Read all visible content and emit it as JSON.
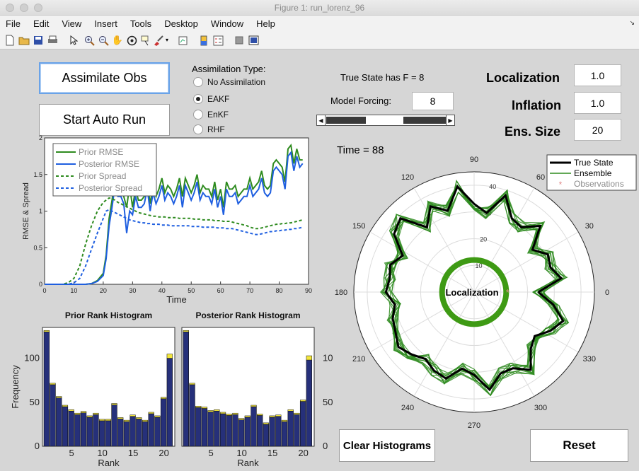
{
  "window": {
    "title": "Figure 1: run_lorenz_96"
  },
  "menu": [
    "File",
    "Edit",
    "View",
    "Insert",
    "Tools",
    "Desktop",
    "Window",
    "Help"
  ],
  "toolbar_icons": [
    "new-figure-icon",
    "open-file-icon",
    "save-icon",
    "print-icon",
    "pointer-icon",
    "zoom-in-icon",
    "zoom-out-icon",
    "pan-hand-icon",
    "rotate-3d-icon",
    "data-cursor-icon",
    "brush-icon",
    "link-plot-icon",
    "colorbar-icon",
    "legend-icon",
    "hide-plot-tools-icon",
    "show-plot-tools-icon"
  ],
  "controls": {
    "assimilate_obs": "Assimilate Obs",
    "start_auto_run": "Start Auto Run",
    "assimilation_type_label": "Assimilation Type:",
    "assimilation_types": [
      "No Assimilation",
      "EAKF",
      "EnKF",
      "RHF"
    ],
    "assimilation_selected": "EAKF",
    "true_state_text": "True State has F = 8",
    "model_forcing_label": "Model Forcing:",
    "model_forcing_value": "8",
    "forcing_slider_position": 0.52,
    "localization_label": "Localization",
    "localization_value": "1.0",
    "inflation_label": "Inflation",
    "inflation_value": "1.0",
    "ens_size_label": "Ens. Size",
    "ens_size_value": "20",
    "time_text": "Time = 88",
    "clear_histograms": "Clear Histograms",
    "reset": "Reset"
  },
  "chart_data": [
    {
      "type": "line",
      "ylabel": "RMSE & Spread",
      "xlabel": "Time",
      "xlim": [
        0,
        90
      ],
      "ylim": [
        0,
        2
      ],
      "xticks": [
        "0",
        "10",
        "20",
        "30",
        "40",
        "50",
        "60",
        "70",
        "80",
        "90"
      ],
      "yticks": [
        "0",
        "0.5",
        "1",
        "1.5",
        "2"
      ],
      "legend": [
        "Prior RMSE",
        "Posterior RMSE",
        "Prior Spread",
        "Posterior Spread"
      ],
      "legend_position": "top-left",
      "colors": {
        "prior": "#2e8b1f",
        "posterior": "#1f5fe0"
      },
      "x": [
        0,
        2,
        4,
        6,
        8,
        10,
        12,
        14,
        16,
        18,
        20,
        21,
        22,
        23,
        24,
        25,
        26,
        27,
        28,
        29,
        30,
        31,
        32,
        33,
        34,
        35,
        36,
        37,
        38,
        39,
        40,
        41,
        42,
        43,
        44,
        45,
        46,
        47,
        48,
        49,
        50,
        51,
        52,
        53,
        54,
        55,
        56,
        57,
        58,
        59,
        60,
        61,
        62,
        63,
        64,
        65,
        66,
        67,
        68,
        69,
        70,
        71,
        72,
        73,
        74,
        75,
        76,
        77,
        78,
        79,
        80,
        81,
        82,
        83,
        84,
        85,
        86,
        87,
        88
      ],
      "series": [
        {
          "name": "Prior RMSE",
          "values": [
            0,
            0,
            0,
            0,
            0,
            0,
            0,
            0,
            0.01,
            0.05,
            0.15,
            0.4,
            0.9,
            1.15,
            1.45,
            1.3,
            1.25,
            1.2,
            1.05,
            1.35,
            1.05,
            1.3,
            1.15,
            1.15,
            1.2,
            1.4,
            1.1,
            1.35,
            1.2,
            1.3,
            1.45,
            1.25,
            1.35,
            1.3,
            1.2,
            1.3,
            1.45,
            1.2,
            1.45,
            1.35,
            1.25,
            1.35,
            1.5,
            1.25,
            1.35,
            1.3,
            1.3,
            1.2,
            1.4,
            1.15,
            1.3,
            1.05,
            1.4,
            1.3,
            1.3,
            1.35,
            1.2,
            1.25,
            1.3,
            1.3,
            1.45,
            1.3,
            1.35,
            1.4,
            1.55,
            1.35,
            1.3,
            1.35,
            1.65,
            1.7,
            1.65,
            1.6,
            1.4,
            1.85,
            1.9,
            1.65,
            1.85,
            1.7,
            1.7
          ]
        },
        {
          "name": "Posterior RMSE",
          "values": [
            0,
            0,
            0,
            0,
            0,
            0,
            0,
            0,
            0.01,
            0.04,
            0.12,
            0.35,
            0.8,
            1.05,
            1.35,
            1.2,
            1.2,
            1.1,
            0.7,
            1.0,
            0.95,
            1.2,
            1.05,
            1.05,
            1.1,
            1.3,
            1.0,
            1.25,
            1.1,
            1.2,
            1.35,
            1.15,
            1.25,
            1.2,
            1.1,
            1.2,
            1.35,
            1.05,
            1.35,
            1.25,
            1.15,
            1.25,
            1.4,
            1.15,
            1.25,
            1.2,
            1.2,
            1.1,
            1.3,
            1.05,
            1.2,
            0.95,
            1.3,
            1.2,
            1.2,
            1.25,
            1.1,
            1.15,
            1.2,
            1.2,
            1.35,
            1.2,
            1.25,
            1.3,
            1.45,
            1.25,
            1.2,
            1.25,
            1.55,
            1.6,
            1.55,
            1.5,
            1.3,
            1.75,
            1.8,
            1.55,
            1.75,
            1.6,
            1.65
          ]
        },
        {
          "name": "Prior Spread",
          "values": [
            0,
            0,
            0,
            0,
            0.02,
            0.08,
            0.25,
            0.55,
            0.8,
            1.0,
            1.12,
            1.15,
            1.18,
            1.17,
            1.15,
            1.12,
            1.1,
            1.08,
            1.06,
            1.04,
            1.02,
            1.0,
            0.98,
            0.97,
            0.96,
            0.95,
            0.94,
            0.93,
            0.93,
            0.92,
            0.92,
            0.92,
            0.91,
            0.91,
            0.91,
            0.91,
            0.9,
            0.9,
            0.9,
            0.9,
            0.9,
            0.89,
            0.89,
            0.89,
            0.88,
            0.88,
            0.88,
            0.88,
            0.87,
            0.87,
            0.87,
            0.86,
            0.86,
            0.86,
            0.85,
            0.84,
            0.83,
            0.82,
            0.81,
            0.8,
            0.78,
            0.77,
            0.76,
            0.76,
            0.77,
            0.78,
            0.79,
            0.8,
            0.81,
            0.82,
            0.82,
            0.83,
            0.83,
            0.84,
            0.84,
            0.85,
            0.86,
            0.87,
            0.88
          ]
        },
        {
          "name": "Posterior Spread",
          "values": [
            0,
            0,
            0,
            0,
            0,
            0.02,
            0.08,
            0.25,
            0.48,
            0.7,
            0.9,
            1.0,
            1.02,
            1.0,
            0.98,
            0.96,
            0.94,
            0.92,
            0.9,
            0.88,
            0.87,
            0.86,
            0.85,
            0.84,
            0.84,
            0.83,
            0.83,
            0.82,
            0.82,
            0.82,
            0.81,
            0.81,
            0.81,
            0.8,
            0.8,
            0.8,
            0.8,
            0.8,
            0.8,
            0.8,
            0.79,
            0.79,
            0.79,
            0.79,
            0.78,
            0.78,
            0.78,
            0.78,
            0.78,
            0.77,
            0.77,
            0.77,
            0.76,
            0.76,
            0.76,
            0.75,
            0.74,
            0.73,
            0.72,
            0.71,
            0.7,
            0.69,
            0.68,
            0.68,
            0.69,
            0.7,
            0.71,
            0.72,
            0.72,
            0.73,
            0.73,
            0.74,
            0.74,
            0.75,
            0.75,
            0.76,
            0.76,
            0.77,
            0.78
          ]
        }
      ]
    },
    {
      "type": "bar",
      "title": "Prior Rank Histogram",
      "xlabel": "Rank",
      "ylabel": "Frequency",
      "xticks": [
        "5",
        "10",
        "15",
        "20"
      ],
      "yticks": [
        "0",
        "50",
        "100"
      ],
      "ylim": [
        0,
        135
      ],
      "bar_color": "#26307a",
      "highlight_color": "#f3e63b",
      "categories": [
        "1",
        "2",
        "3",
        "4",
        "5",
        "6",
        "7",
        "8",
        "9",
        "10",
        "11",
        "12",
        "13",
        "14",
        "15",
        "16",
        "17",
        "18",
        "19",
        "20",
        "21"
      ],
      "values": [
        130,
        70,
        55,
        45,
        40,
        36,
        38,
        33,
        36,
        29,
        29,
        47,
        31,
        28,
        34,
        31,
        28,
        37,
        33,
        54,
        100
      ],
      "highlighted_rank": 21
    },
    {
      "type": "bar",
      "title": "Posterior Rank Histogram",
      "xlabel": "Rank",
      "ylabel": "Frequency",
      "xticks": [
        "5",
        "10",
        "15",
        "20"
      ],
      "yticks": [
        "0",
        "50",
        "100"
      ],
      "ylim": [
        0,
        135
      ],
      "bar_color": "#26307a",
      "highlight_color": "#f3e63b",
      "categories": [
        "1",
        "2",
        "3",
        "4",
        "5",
        "6",
        "7",
        "8",
        "9",
        "10",
        "11",
        "12",
        "13",
        "14",
        "15",
        "16",
        "17",
        "18",
        "19",
        "20",
        "21"
      ],
      "values": [
        130,
        70,
        44,
        43,
        39,
        40,
        37,
        35,
        36,
        30,
        33,
        45,
        35,
        25,
        33,
        34,
        28,
        40,
        36,
        51,
        98
      ],
      "highlighted_rank": 21
    },
    {
      "type": "polar",
      "angle_ticks": [
        "0",
        "30",
        "60",
        "90",
        "120",
        "150",
        "180",
        "210",
        "240",
        "270",
        "300",
        "330"
      ],
      "radius_ticks": [
        "10",
        "20",
        "30",
        "40"
      ],
      "rmax": 45,
      "legend": [
        "True State",
        "Ensemble",
        "Observations"
      ],
      "legend_position": "top-right",
      "center_label": "Localization",
      "localization_ring_radius": 12,
      "true_state_radius": [
        24,
        33,
        30,
        31,
        27,
        35,
        30,
        31,
        38,
        30,
        33,
        40,
        32,
        36,
        30,
        39,
        37,
        30,
        33,
        32,
        33,
        30,
        32,
        33,
        35,
        33,
        31,
        33,
        34,
        29,
        31,
        37,
        32,
        32,
        36,
        30,
        28,
        32,
        35,
        30
      ],
      "ensemble_spread": 2.2,
      "colors": {
        "true_state": "#000000",
        "ensemble": "#2e8b1f",
        "observations": "#e08a8a",
        "ring": "#3e9a14"
      }
    }
  ]
}
